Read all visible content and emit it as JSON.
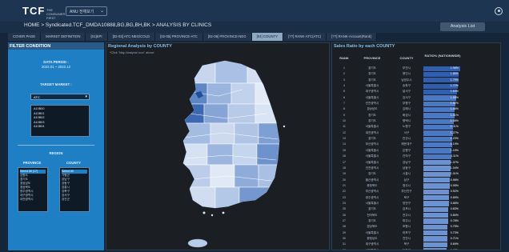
{
  "header": {
    "logo": "TCF",
    "logo_sub": "THE CONSUMER FIRST",
    "project_select": "ANU 전체보기",
    "analysis_button": "Analysis List"
  },
  "breadcrumb": "HOME > Syndicated.TCF_DMDA10888,BG,BG,BH,BK > ANALYSIS BY CLINICS",
  "tabs": [
    {
      "label": "COVER PAGE"
    },
    {
      "label": "MARKET DEFINITION"
    },
    {
      "label": "[01]KPI"
    },
    {
      "label": "[02-03] ATC-NEG/COLD"
    },
    {
      "label": "[02-05] PROVINCE-ATC"
    },
    {
      "label": "[02-06] PROVINCE-NEG"
    },
    {
      "label": "[04] COUNTY"
    },
    {
      "label": "[??] RANK-ATC(ATC)"
    },
    {
      "label": "[??] RANK-Account(Rank)"
    }
  ],
  "filter": {
    "title": "FILTER CONDITION",
    "data_period_label": "DATA PERIOD :",
    "data_period_value": "2022.01 ~ 2022.12",
    "target_market_label": "TARGET MARKET :",
    "market_selected": "ATC",
    "market_items": [
      "A10B00",
      "A10B01",
      "A10B02",
      "A10B03",
      "A10B04"
    ],
    "region_label": "REGION",
    "province_label": "PROVINCE",
    "county_label": "COUNTY",
    "provinces": [
      "Select All (17)",
      "강원도",
      "경기도",
      "경상남도",
      "경상북도",
      "광주광역시",
      "대구광역시",
      "대전광역시"
    ],
    "counties": [
      "Select All",
      "가평군",
      "강남구",
      "강동구",
      "강릉시",
      "강북구",
      "강서구",
      "강진군"
    ]
  },
  "map": {
    "title": "Regional Analysis by COUNTY",
    "subtitle": "*Click \"Map Analysis Icon\" above"
  },
  "table": {
    "title": "Sales Ratio by each COUNTY",
    "columns": [
      "RANK",
      "PROVINCE",
      "COUNTY",
      "RATIO% (NATIONWIDE)"
    ],
    "rows": [
      {
        "rank": "1",
        "province": "경기도",
        "county": "부천시",
        "ratio": 1.98
      },
      {
        "rank": "2",
        "province": "경기도",
        "county": "용인시",
        "ratio": 1.86
      },
      {
        "rank": "3",
        "province": "경기도",
        "county": "남양주시",
        "ratio": 1.79
      },
      {
        "rank": "4",
        "province": "서울특별시",
        "county": "송파구",
        "ratio": 1.72
      },
      {
        "rank": "5",
        "province": "대구광역시",
        "county": "달서구",
        "ratio": 1.64
      },
      {
        "rank": "6",
        "province": "서울특별시",
        "county": "강서구",
        "ratio": 1.58
      },
      {
        "rank": "7",
        "province": "인천광역시",
        "county": "부평구",
        "ratio": 1.52
      },
      {
        "rank": "8",
        "province": "경상남도",
        "county": "김해시",
        "ratio": 1.46
      },
      {
        "rank": "9",
        "province": "경기도",
        "county": "화성시",
        "ratio": 1.41
      },
      {
        "rank": "10",
        "province": "경기도",
        "county": "평택시",
        "ratio": 1.36
      },
      {
        "rank": "11",
        "province": "서울특별시",
        "county": "노원구",
        "ratio": 1.31
      },
      {
        "rank": "12",
        "province": "대전광역시",
        "county": "서구",
        "ratio": 1.27
      },
      {
        "rank": "13",
        "province": "경기도",
        "county": "안산시",
        "ratio": 1.23
      },
      {
        "rank": "14",
        "province": "부산광역시",
        "county": "해운대구",
        "ratio": 1.19
      },
      {
        "rank": "15",
        "province": "서울특별시",
        "county": "은평구",
        "ratio": 1.15
      },
      {
        "rank": "16",
        "province": "서울특별시",
        "county": "관악구",
        "ratio": 1.11
      },
      {
        "rank": "17",
        "province": "서울특별시",
        "county": "강남구",
        "ratio": 1.07
      },
      {
        "rank": "18",
        "province": "인천광역시",
        "county": "남동구",
        "ratio": 1.04
      },
      {
        "rank": "19",
        "province": "경기도",
        "county": "시흥시",
        "ratio": 1.01
      },
      {
        "rank": "20",
        "province": "울산광역시",
        "county": "남구",
        "ratio": 0.98
      },
      {
        "rank": "21",
        "province": "충청북도",
        "county": "청주시",
        "ratio": 0.95
      },
      {
        "rank": "22",
        "province": "부산광역시",
        "county": "부산진구",
        "ratio": 0.92
      },
      {
        "rank": "23",
        "province": "광주광역시",
        "county": "북구",
        "ratio": 0.89
      },
      {
        "rank": "24",
        "province": "서울특별시",
        "county": "양천구",
        "ratio": 0.86
      },
      {
        "rank": "25",
        "province": "경기도",
        "county": "김포시",
        "ratio": 0.83
      },
      {
        "rank": "26",
        "province": "전라북도",
        "county": "전주시",
        "ratio": 0.8
      },
      {
        "rank": "27",
        "province": "경기도",
        "county": "파주시",
        "ratio": 0.78
      },
      {
        "rank": "28",
        "province": "경상북도",
        "county": "포항시",
        "ratio": 0.75
      },
      {
        "rank": "29",
        "province": "서울특별시",
        "county": "마포구",
        "ratio": 0.73
      },
      {
        "rank": "30",
        "province": "충청남도",
        "county": "천안시",
        "ratio": 0.71
      },
      {
        "rank": "31",
        "province": "대구광역시",
        "county": "북구",
        "ratio": 0.69
      },
      {
        "rank": "32",
        "province": "서울특별시",
        "county": "동작구",
        "ratio": 0.67
      }
    ]
  },
  "colors": {
    "accent": "#1f7fc4",
    "bar": "#4f7fc9",
    "map_high": "#2e5da8",
    "map_low": "#e8eef8"
  }
}
